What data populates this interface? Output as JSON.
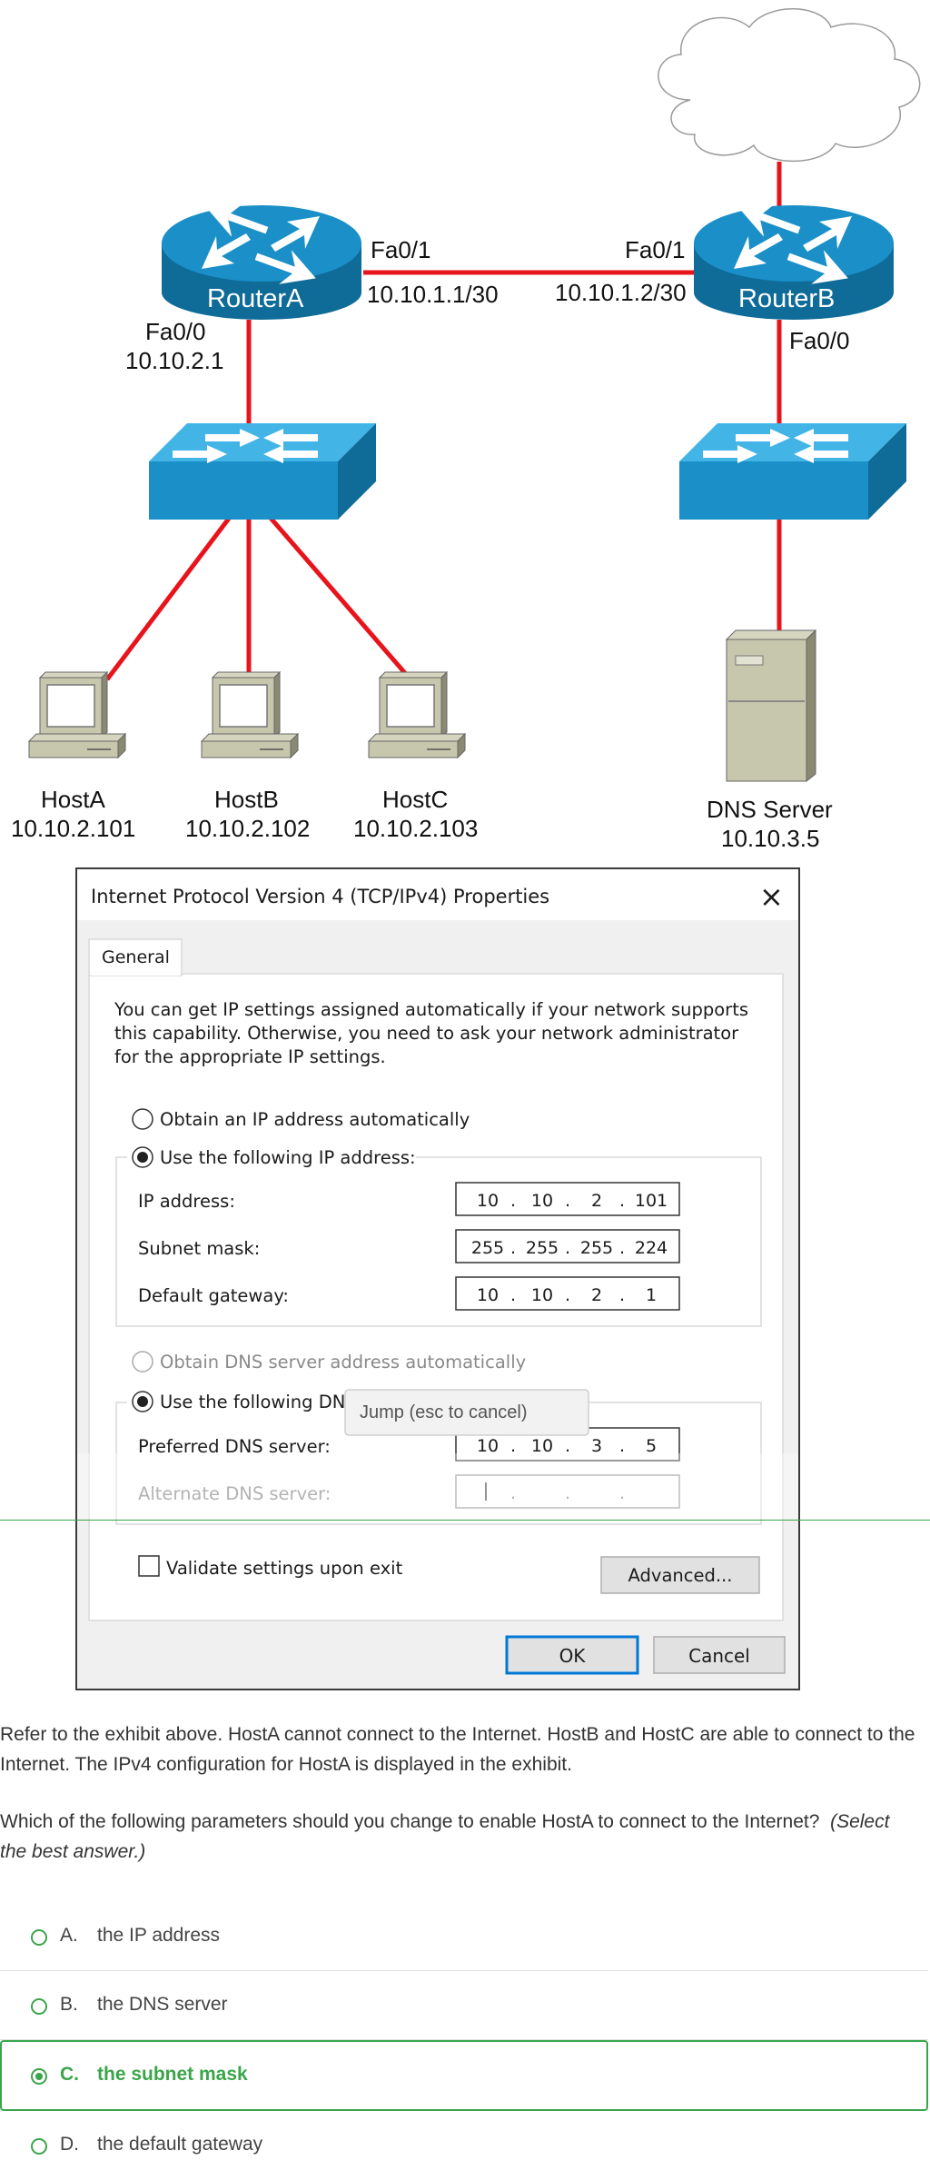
{
  "diagram": {
    "router_a": {
      "name": "RouterA",
      "fa01": "Fa0/1",
      "fa01_ip": "10.10.1.1/30",
      "fa00": "Fa0/0",
      "fa00_ip": "10.10.2.1"
    },
    "router_b": {
      "name": "RouterB",
      "fa01": "Fa0/1",
      "fa01_ip": "10.10.1.2/30",
      "fa00": "Fa0/0"
    },
    "hosts": [
      {
        "name": "HostA",
        "ip": "10.10.2.101"
      },
      {
        "name": "HostB",
        "ip": "10.10.2.102"
      },
      {
        "name": "HostC",
        "ip": "10.10.2.103"
      }
    ],
    "dns_server": {
      "name": "DNS Server",
      "ip": "10.10.3.5"
    },
    "colors": {
      "link": "#e8141c",
      "device": "#1a8fc8",
      "device_dark": "#0f6b98"
    }
  },
  "dialog": {
    "title": "Internet Protocol Version 4 (TCP/IPv4) Properties",
    "close_glyph": "×",
    "tab": "General",
    "description": [
      "You can get IP settings assigned automatically if your network supports",
      "this capability. Otherwise, you need to ask your network administrator",
      "for the appropriate IP settings."
    ],
    "obtain_ip_auto": "Obtain an IP address automatically",
    "use_following_ip": "Use the following IP address:",
    "ip_label": "IP address:",
    "ip_octets": [
      "10",
      "10",
      "2",
      "101"
    ],
    "mask_label": "Subnet mask:",
    "mask_octets": [
      "255",
      "255",
      "255",
      "224"
    ],
    "gateway_label": "Default gateway:",
    "gateway_octets": [
      "10",
      "10",
      "2",
      "1"
    ],
    "obtain_dns_auto": "Obtain DNS server address automatically",
    "use_following_dns": "Use the following DNS",
    "tooltip": "Jump (esc to cancel)",
    "preferred_dns_label": "Preferred DNS server:",
    "preferred_dns_octets": [
      "10",
      "10",
      "3",
      "5"
    ],
    "alternate_dns_label": "Alternate DNS server:",
    "validate_label": "Validate settings upon exit",
    "advanced_button": "Advanced...",
    "ok_button": "OK",
    "cancel_button": "Cancel"
  },
  "question": {
    "paragraph1": "Refer to the exhibit above. HostA cannot connect to the Internet. HostB and HostC are able to connect to the Internet. The IPv4 configuration for HostA is displayed in the exhibit.",
    "paragraph2": "Which of the following parameters should you change to enable HostA to connect to the Internet?",
    "hint": "(Select the best answer.)"
  },
  "options": [
    {
      "letter": "A.",
      "text": "the IP address",
      "selected": false
    },
    {
      "letter": "B.",
      "text": "the DNS server",
      "selected": false
    },
    {
      "letter": "C.",
      "text": "the subnet mask",
      "selected": true
    },
    {
      "letter": "D.",
      "text": "the default gateway",
      "selected": false
    }
  ],
  "accent_color": "#3aa54a"
}
